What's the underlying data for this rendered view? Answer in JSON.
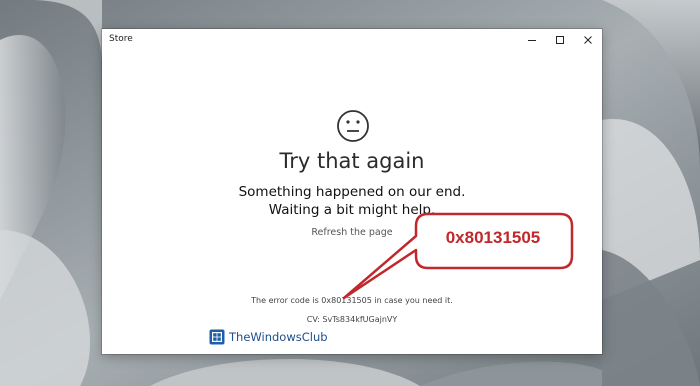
{
  "window": {
    "title": "Store",
    "controls": {
      "minimize_icon": "minimize-icon",
      "maximize_icon": "maximize-icon",
      "close_icon": "close-icon"
    }
  },
  "error_page": {
    "icon": "neutral-face-icon",
    "heading": "Try that again",
    "message": "Something happened on our end. Waiting a bit might help.",
    "refresh_link": "Refresh the page",
    "error_code_line": "The error code is 0x80131505 in case you need it.",
    "cv_line": "CV: SvTs834kfUGajnVY"
  },
  "annotation": {
    "callout_text": "0x80131505",
    "border_color": "#c0282c"
  },
  "watermark": {
    "text": "TheWindowsClub",
    "logo_icon": "windowsclub-logo-icon",
    "color": "#1f4e8c"
  }
}
